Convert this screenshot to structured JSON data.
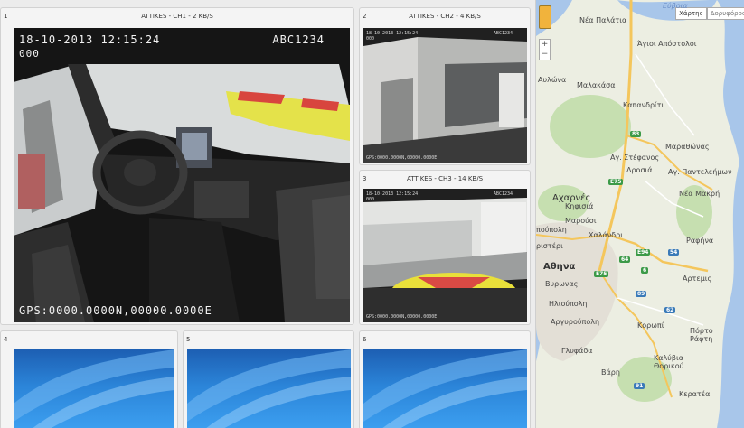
{
  "panels": [
    {
      "number": "1",
      "title": "ATTIKES - CH1 - 2 KB/S"
    },
    {
      "number": "2",
      "title": "ATTIKES - CH2 - 4 KB/S"
    },
    {
      "number": "3",
      "title": "ATTIKES - CH3 - 14 KB/S"
    },
    {
      "number": "4",
      "title": ""
    },
    {
      "number": "5",
      "title": ""
    },
    {
      "number": "6",
      "title": ""
    }
  ],
  "cam1": {
    "datetime": "18-10-2013 12:15:24",
    "plate": "ABC1234",
    "counter": "000",
    "gps": "GPS:0000.0000N,00000.0000E"
  },
  "cam2": {
    "datetime": "18-10-2013 12:15:24",
    "plate": "ABC1234",
    "counter": "000",
    "gps": "GPS:0000.0000N,00000.0000E"
  },
  "cam3": {
    "datetime": "18-10-2013 12:15:24",
    "plate": "ABC1234",
    "counter": "000",
    "gps": "GPS:0000.0000N,00000.0000E"
  },
  "map": {
    "tab_map": "Χάρτης",
    "tab_sat": "Δορυφόρος",
    "zoom_in": "+",
    "zoom_out": "−",
    "places": {
      "nea_palatia": "Νέα Παλάτια",
      "agioi_apostoloi": "Άγιοι Απόστολοι",
      "avlona": "Αυλώνα",
      "malakasa": "Μαλακάσα",
      "kapandriti": "Καπανδρίτι",
      "marathonas": "Μαραθώνας",
      "ag_stefanos": "Αγ. Στέφανος",
      "drosia": "Δροσιά",
      "ag_panteleimon": "Αγ. Παντελεήμων",
      "acharnes": "Αχαρνές",
      "kifisia": "Κηφισιά",
      "nea_makri": "Νέα Μακρή",
      "marousi": "Μαρούσι",
      "poulopoli": "πούπολη",
      "chalandri": "Χαλάνδρι",
      "peristeri": "ριστέρι",
      "rafina": "Ραφήνα",
      "athina": "Αθηνα",
      "vyronas": "Βυρωνας",
      "artemis": "Αρτεμις",
      "ilioupoli": "Ηλιούπολη",
      "argyroupoli": "Αργυρούπολη",
      "koropi": "Κορωπί",
      "porto_rafti": "Πόρτο Ράφτη",
      "glyfada": "Γλυφάδα",
      "vari": "Βάρη",
      "kalyvia": "Καλύβια Θορικού",
      "keratea": "Κερατέα",
      "evia": "Εύβοια"
    },
    "roads": [
      "83",
      "E75",
      "E75",
      "E94",
      "54",
      "64",
      "6",
      "89",
      "62",
      "91"
    ]
  }
}
